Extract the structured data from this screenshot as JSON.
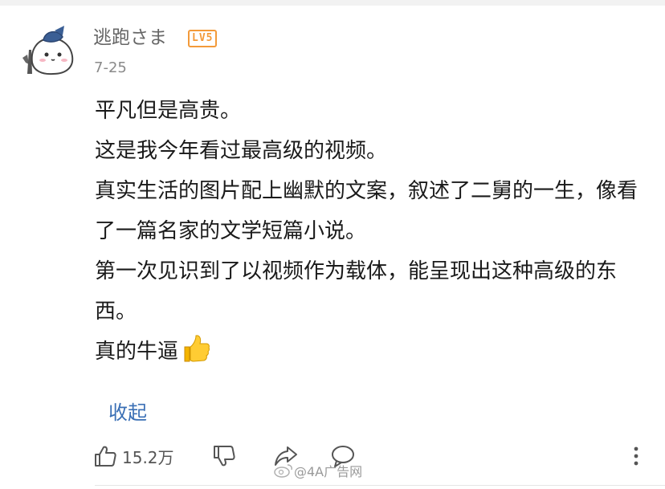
{
  "comment": {
    "user": {
      "name": "逃跑さま",
      "level": "LV5",
      "avatar_icon": "cat-avatar-icon"
    },
    "date": "7-25",
    "lines": [
      "平凡但是高贵。",
      "这是我今年看过最高级的视频。",
      "真实生活的图片配上幽默的文案，叙述了二舅的一生，像看了一篇名家的文学短篇小说。",
      "第一次见识到了以视频作为载体，能呈现出这种高级的东西。"
    ],
    "last_line": "真的牛逼",
    "collapse_label": "收起"
  },
  "actions": {
    "like_icon": "thumbs-up-icon",
    "like_count": "15.2万",
    "dislike_icon": "thumbs-down-icon",
    "share_icon": "share-icon",
    "reply_icon": "comment-icon",
    "more_icon": "more-vertical-icon"
  },
  "watermark": {
    "text": "@4A广告网",
    "icon": "weibo-icon"
  },
  "colors": {
    "level_badge": "#f39a3a",
    "link": "#3a6fb5",
    "meta_text": "#8a8a8a"
  }
}
